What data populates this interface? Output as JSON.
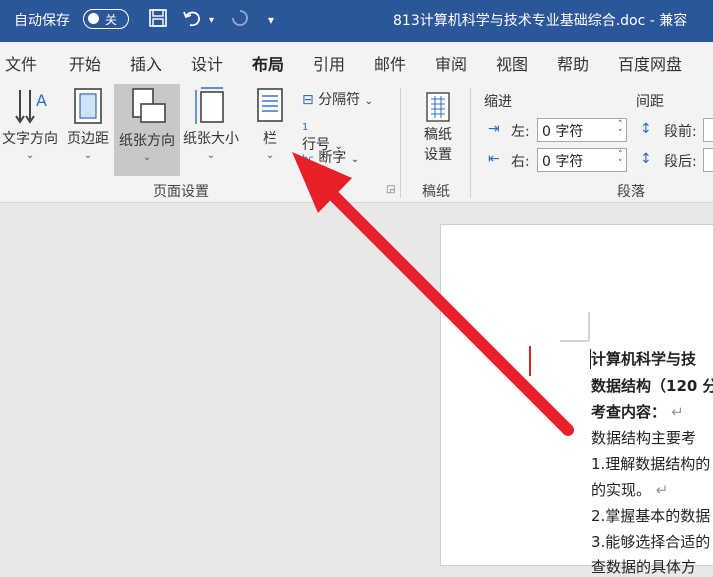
{
  "titlebar": {
    "autosave_label": "自动保存",
    "toggle_state": "关",
    "doc_title": "813计算机科学与技术专业基础综合.doc  -  兼容"
  },
  "tabs": [
    "文件",
    "开始",
    "插入",
    "设计",
    "布局",
    "引用",
    "邮件",
    "审阅",
    "视图",
    "帮助",
    "百度网盘"
  ],
  "active_tab": "布局",
  "ribbon": {
    "text_direction": "文字方向",
    "margins": "页边距",
    "orientation": "纸张方向",
    "size": "纸张大小",
    "columns": "栏",
    "breaks": "分隔符",
    "line_numbers": "行号",
    "hyphenation": "断字",
    "page_setup_group": "页面设置",
    "draft_settings": "稿纸设置",
    "draft_settings_l1": "稿纸",
    "draft_settings_l2": "设置",
    "draft_group": "稿纸",
    "indent_label": "缩进",
    "spacing_label": "间距",
    "left_label": "左:",
    "right_label": "右:",
    "left_value": "0 字符",
    "right_value": "0 字符",
    "before_label": "段前:",
    "after_label": "段后:",
    "paragraph_group": "段落"
  },
  "document": {
    "line1": "计算机科学与技",
    "line2": "数据结构（120 分",
    "line3": "考查内容：",
    "line4": "数据结构主要考",
    "line5": "1.理解数据结构的",
    "line6": "的实现。",
    "line7": "2.掌握基本的数据",
    "line8": "3.能够选择合适的",
    "line9": "查数据的具体方"
  },
  "colors": {
    "titlebar": "#2b579a",
    "arrow": "#e8202a"
  }
}
